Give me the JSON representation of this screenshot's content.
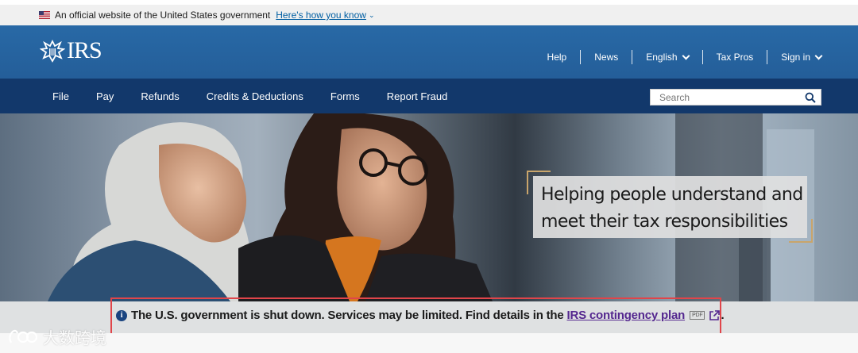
{
  "gov_banner": {
    "text": "An official website of the United States government",
    "link": "Here's how you know"
  },
  "header": {
    "logo_text": "IRS",
    "utility_nav": [
      "Help",
      "News",
      "English",
      "Tax Pros",
      "Sign in"
    ]
  },
  "nav": {
    "items": [
      "File",
      "Pay",
      "Refunds",
      "Credits & Deductions",
      "Forms",
      "Report Fraud"
    ],
    "search_placeholder": "Search"
  },
  "hero": {
    "tagline": "Helping people understand and meet their tax responsibilities"
  },
  "alert": {
    "text": "The U.S. government is shut down. Services may be limited. Find details in the",
    "link": "IRS contingency plan",
    "badge": "PDF",
    "period": "."
  },
  "watermark": {
    "text": "大数跨境"
  },
  "colors": {
    "header_blue": "#2869a6",
    "nav_navy": "#12386b",
    "alert_bg": "#dfe1e2",
    "visited_link": "#54278f",
    "highlight_frame": "#e0454a",
    "bracket_gold": "#c9a56b"
  }
}
